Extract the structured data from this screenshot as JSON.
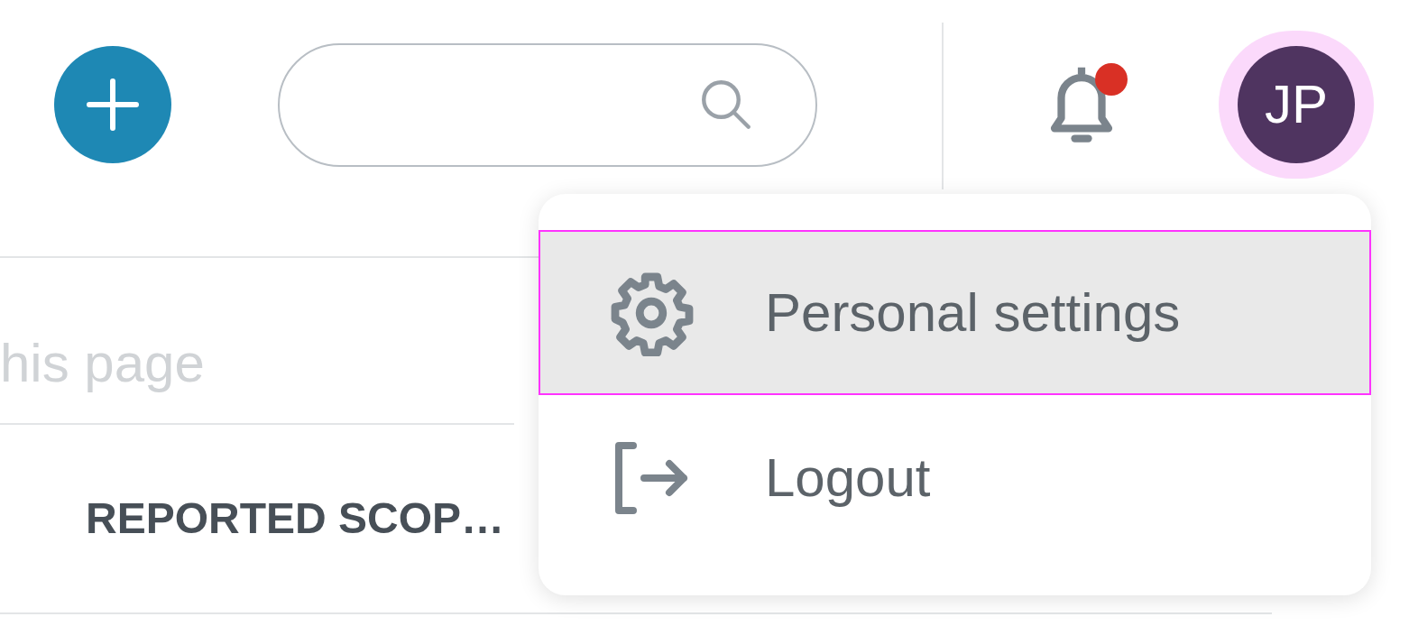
{
  "header": {
    "notifications": {
      "unread": true
    },
    "avatar": {
      "initials": "JP"
    }
  },
  "content": {
    "search_hint": "his page",
    "column_heading": "REPORTED SCOP…"
  },
  "user_menu": {
    "items": [
      {
        "kind": "settings",
        "label": "Personal settings",
        "selected": true
      },
      {
        "kind": "logout",
        "label": "Logout",
        "selected": false
      }
    ]
  }
}
